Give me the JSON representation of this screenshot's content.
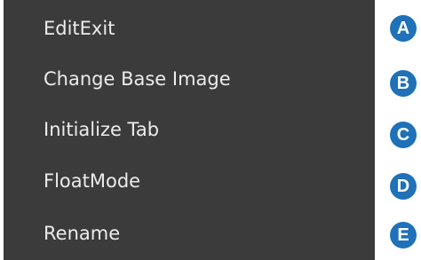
{
  "context_menu": {
    "items": [
      {
        "label": "EditExit"
      },
      {
        "label": "Change Base Image"
      },
      {
        "label": "Initialize Tab"
      },
      {
        "label": "FloatMode"
      },
      {
        "label": "Rename"
      }
    ],
    "background_color": "#3b3b3b",
    "text_color": "#ececec"
  },
  "callouts": {
    "labels": [
      "A",
      "B",
      "C",
      "D",
      "E"
    ],
    "color": "#1f71b8"
  }
}
